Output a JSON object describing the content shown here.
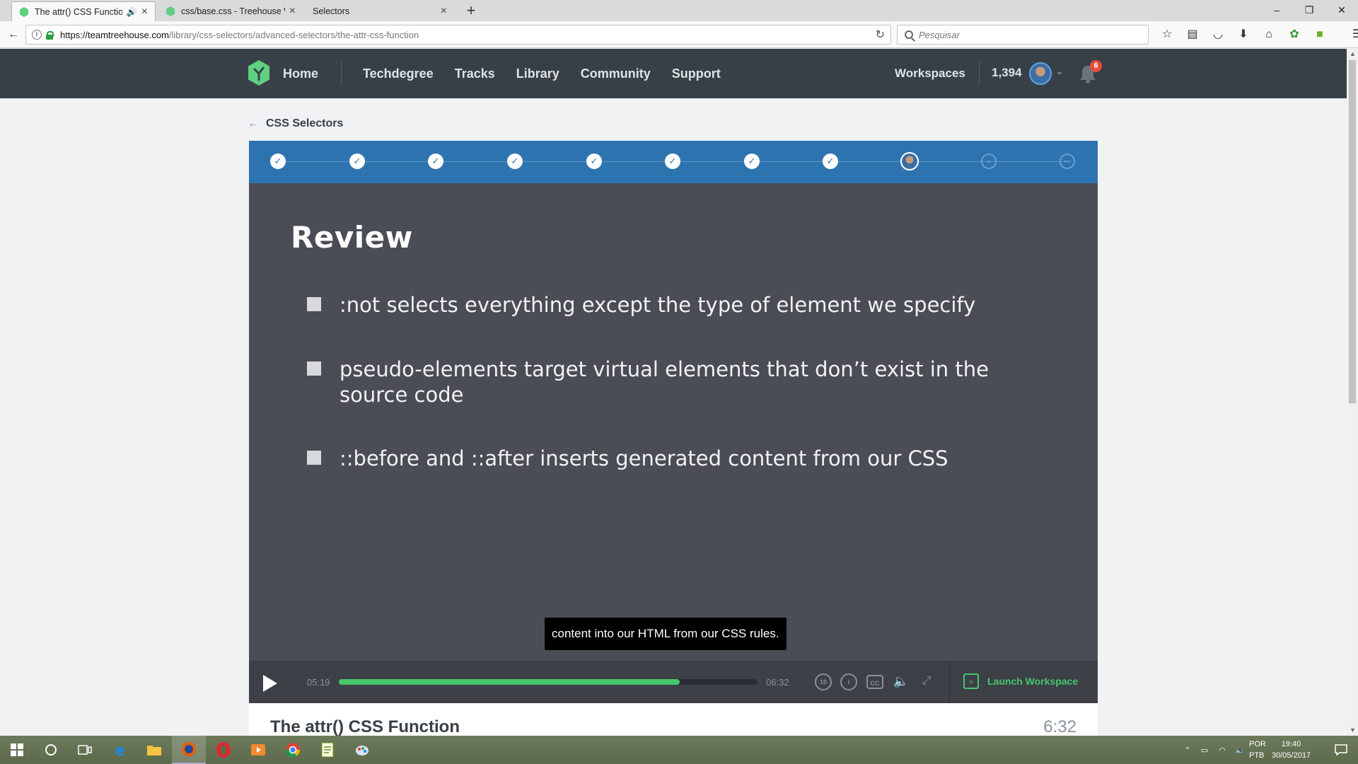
{
  "browser": {
    "tabs": [
      {
        "title": "The attr() CSS Function |",
        "active": true,
        "audio": true
      },
      {
        "title": "css/base.css - Treehouse Wo",
        "active": false
      },
      {
        "title": "Selectors",
        "active": false
      }
    ],
    "url_host": "https://teamtreehouse.com",
    "url_path": "/library/css-selectors/advanced-selectors/the-attr-css-function",
    "search_placeholder": "Pesquisar"
  },
  "site": {
    "nav": {
      "home": "Home",
      "techdegree": "Techdegree",
      "tracks": "Tracks",
      "library": "Library",
      "community": "Community",
      "support": "Support",
      "workspaces": "Workspaces"
    },
    "points": "1,394",
    "notifications": "6"
  },
  "breadcrumb": "CSS Selectors",
  "steps": {
    "completed_count": 8,
    "states": [
      "done",
      "done",
      "done",
      "done",
      "done",
      "done",
      "done",
      "done",
      "current",
      "code",
      "quiz"
    ]
  },
  "slide": {
    "title": "Review",
    "bullets": [
      ":not selects everything except the type of element we specify",
      "pseudo-elements target virtual elements that don’t exist in the source code",
      "::before and ::after inserts generated content from our CSS"
    ]
  },
  "caption": "content into our HTML from our CSS rules.",
  "player": {
    "current_time": "05:19",
    "total_time": "06:32",
    "progress": 0.814,
    "launch_label": "Launch Workspace"
  },
  "video_below": {
    "title": "The attr() CSS Function",
    "duration": "6:32"
  },
  "taskbar": {
    "lang1": "POR",
    "lang2": "PTB",
    "time": "19:40",
    "date": "30/05/2017"
  },
  "colors": {
    "header": "#384047",
    "stepbar": "#2d73b0",
    "slide_bg": "#4a4d56",
    "accent_green": "#45c76b"
  }
}
